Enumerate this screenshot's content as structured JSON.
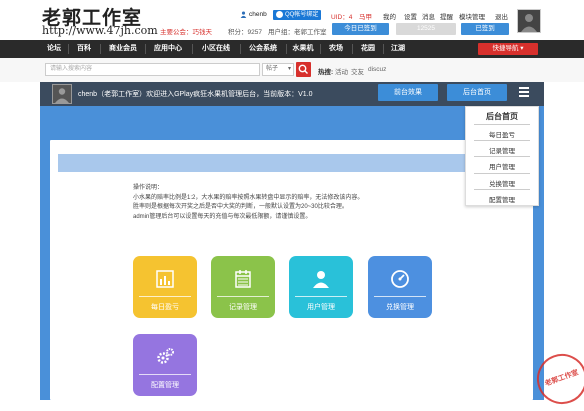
{
  "header": {
    "logo_text": "老郭工作室",
    "logo_url": "http://www.47jh.com",
    "notice_label": "主要公会：",
    "notice_value": "巧钱天",
    "points_label": "积分：9257",
    "user_icon": "user-icon",
    "username": "chenb",
    "qq_badge": "QQ帐号绑定",
    "uid_label": "UID：4",
    "uid_links": [
      "马甲",
      "我的",
      "设置",
      "消息",
      "提醒",
      "模块管理",
      "退出"
    ],
    "group_label": "用户组：老郭工作室",
    "checkin_button": "今日已签到",
    "checkin_status": "已签到",
    "checkin_count": "12525"
  },
  "nav": {
    "items": [
      "论坛",
      "百科",
      "商业会员",
      "应用中心",
      "小区在线",
      "公会系统",
      "水果机",
      "农场",
      "花园",
      "江湖"
    ],
    "quick_nav": "快捷导航"
  },
  "search": {
    "placeholder": "请输入搜索内容",
    "select_value": "帖子",
    "hot_label": "热搜:",
    "hot_links": [
      "活动",
      "交友",
      "discuz"
    ]
  },
  "admin_bar": {
    "welcome": "chenb（老郭工作室）欢迎进入GPlay疯狂水果机管理后台，当前版本：V1.0",
    "frontend_button": "前台效果",
    "admin_home_button": "后台首页",
    "menu_icon": "hamburger-icon"
  },
  "dropdown": {
    "title": "后台首页",
    "items": [
      "每日盈亏",
      "记录管理",
      "用户管理",
      "兑换管理",
      "配置管理"
    ]
  },
  "instructions": {
    "title": "操作说明：",
    "lines": [
      "小水果的赔率比例是1:2，大水果的赔率按照水果转盘中显示的赔率，无法修改该内容。",
      "胜率则是根据每次开奖之后是否中大奖的判断，一般默认设置为20~30比较合理。",
      "admin管理后台可以设置每天的充值与每次最低限额，请谨慎设置。"
    ]
  },
  "tiles": [
    {
      "label": "每日盈亏",
      "icon": "bar-chart-icon",
      "color": "#f5c330"
    },
    {
      "label": "记录管理",
      "icon": "calendar-icon",
      "color": "#8bc34a"
    },
    {
      "label": "用户管理",
      "icon": "user-icon",
      "color": "#29c1d9"
    },
    {
      "label": "兑换管理",
      "icon": "gauge-icon",
      "color": "#4d90e0"
    },
    {
      "label": "配置管理",
      "icon": "gears-icon",
      "color": "#9575e0"
    }
  ],
  "stamp": "老郭工作室",
  "colors": {
    "nav_bg": "#2a2a2a",
    "admin_bar_bg": "#3b4b5e",
    "main_blue": "#4a90d9",
    "accent_red": "#d7302c",
    "button_blue": "#3c8dd8"
  }
}
